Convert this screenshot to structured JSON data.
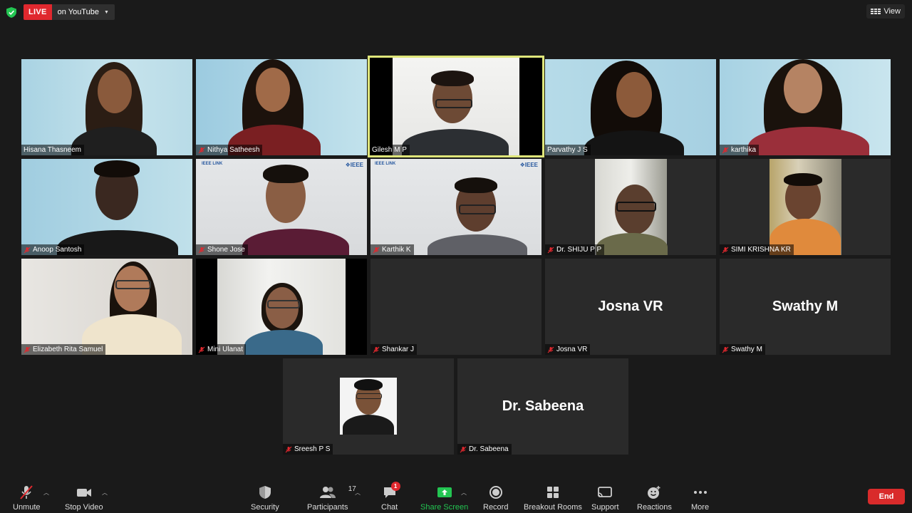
{
  "topbar": {
    "live_label": "LIVE",
    "live_destination": "on YouTube",
    "view_label": "View"
  },
  "participants": [
    {
      "name": "Hisana Thasneem",
      "muted": false,
      "video": true
    },
    {
      "name": "Nithya Satheesh",
      "muted": true,
      "video": true
    },
    {
      "name": "Gilesh M P",
      "muted": false,
      "video": true,
      "active_speaker": true
    },
    {
      "name": "Parvathy J S",
      "muted": false,
      "video": true
    },
    {
      "name": "karthika",
      "muted": true,
      "video": true
    },
    {
      "name": "Anoop Santosh",
      "muted": true,
      "video": true
    },
    {
      "name": "Shone Jose",
      "muted": true,
      "video": true
    },
    {
      "name": "Karthik K",
      "muted": true,
      "video": true
    },
    {
      "name": "Dr. SHIJU P P",
      "muted": true,
      "video": true
    },
    {
      "name": "SIMI KRISHNA KR",
      "muted": true,
      "video": true
    },
    {
      "name": "Elizabeth Rita Samuel",
      "muted": true,
      "video": true
    },
    {
      "name": "Mini Ulanat",
      "muted": true,
      "video": true
    },
    {
      "name": "Shankar J",
      "muted": true,
      "video": false
    },
    {
      "name": "Josna VR",
      "muted": true,
      "video": false,
      "display_name": "Josna VR"
    },
    {
      "name": "Swathy M",
      "muted": true,
      "video": false,
      "display_name": "Swathy M"
    },
    {
      "name": "Sreesh P S",
      "muted": true,
      "video": false
    },
    {
      "name": "Dr. Sabeena",
      "muted": true,
      "video": false,
      "display_name": "Dr. Sabeena"
    }
  ],
  "toolbar": {
    "unmute": "Unmute",
    "stop_video": "Stop Video",
    "security": "Security",
    "participants": "Participants",
    "participant_count": "17",
    "chat": "Chat",
    "chat_badge": "1",
    "share_screen": "Share Screen",
    "record": "Record",
    "breakout_rooms": "Breakout Rooms",
    "support": "Support",
    "reactions": "Reactions",
    "more": "More",
    "end": "End"
  },
  "colors": {
    "background": "#1a1a1a",
    "tile": "#2a2a2a",
    "live_red": "#e0282e",
    "active_speaker_border": "#dfe67a",
    "share_green": "#23c552",
    "end_red": "#d92b2b"
  }
}
